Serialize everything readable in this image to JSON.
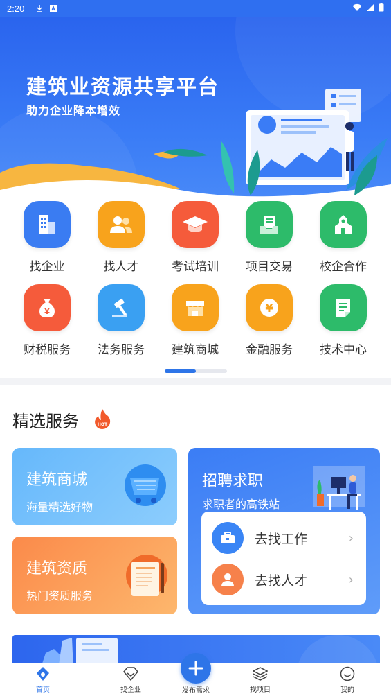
{
  "status_bar": {
    "time": "2:20"
  },
  "banner": {
    "title": "建筑业资源共享平台",
    "subtitle": "助力企业降本增效"
  },
  "grid": [
    {
      "label": "找企业",
      "icon": "building-icon",
      "color": "#3a7cf2"
    },
    {
      "label": "找人才",
      "icon": "people-icon",
      "color": "#f8a31c"
    },
    {
      "label": "考试培训",
      "icon": "graduation-cap-icon",
      "color": "#f55b3b"
    },
    {
      "label": "项目交易",
      "icon": "document-tray-icon",
      "color": "#2dbb6a"
    },
    {
      "label": "校企合作",
      "icon": "school-icon",
      "color": "#2dbb6a"
    },
    {
      "label": "财税服务",
      "icon": "money-bag-icon",
      "color": "#f55b3b"
    },
    {
      "label": "法务服务",
      "icon": "gavel-icon",
      "color": "#3aa0f2"
    },
    {
      "label": "建筑商城",
      "icon": "shop-icon",
      "color": "#f8a31c"
    },
    {
      "label": "金融服务",
      "icon": "yen-coin-icon",
      "color": "#f8a31c"
    },
    {
      "label": "技术中心",
      "icon": "note-icon",
      "color": "#2dbb6a"
    }
  ],
  "featured": {
    "title": "精选服务",
    "hot_badge": "HOT",
    "mall": {
      "title": "建筑商城",
      "subtitle": "海量精选好物"
    },
    "qualification": {
      "title": "建筑资质",
      "subtitle": "热门资质服务"
    },
    "recruit": {
      "title": "招聘求职",
      "subtitle": "求职者的高铁站",
      "find_job": "去找工作",
      "find_talent": "去找人才"
    }
  },
  "tabbar": {
    "home": "首页",
    "find_company": "找企业",
    "publish": "发布需求",
    "find_project": "找项目",
    "mine": "我的",
    "active": "home"
  },
  "colors": {
    "accent": "#2e75e8"
  }
}
